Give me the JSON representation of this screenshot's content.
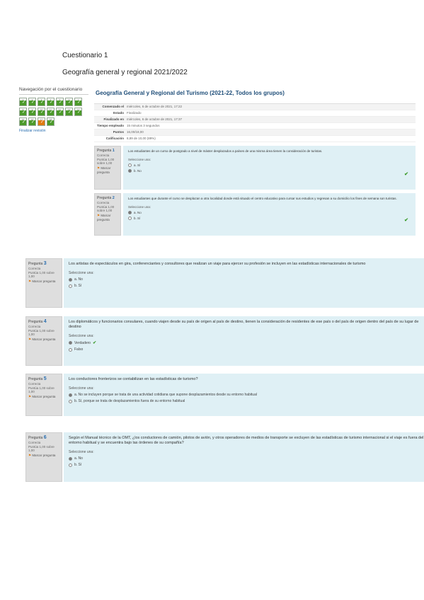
{
  "document": {
    "heading": "Cuestionario 1",
    "subheading": "Geografía general y regional 2021/2022"
  },
  "nav": {
    "title": "Navegación por el cuestionario",
    "cells": [
      "1",
      "2",
      "3",
      "4",
      "5",
      "6",
      "7",
      "8",
      "9",
      "10",
      "11",
      "12",
      "13",
      "14",
      "15",
      "16",
      "17",
      "18"
    ],
    "flagged": [
      16
    ],
    "finish": "Finalizar revisión"
  },
  "course": {
    "title": "Geografía General y Regional del Turismo (2021-22, Todos los grupos)"
  },
  "summary": [
    {
      "k": "Comenzado el",
      "v": "miércoles, 6 de octubre de 2021, 17:22"
    },
    {
      "k": "Estado",
      "v": "Finalizado"
    },
    {
      "k": "Finalizado en",
      "v": "miércoles, 6 de octubre de 2021, 17:37"
    },
    {
      "k": "Tiempo empleado",
      "v": "15 minutos 3 segundos"
    },
    {
      "k": "Puntos",
      "v": "16,00/18,00"
    },
    {
      "k": "Calificación",
      "v": "8,89 de 10,00 (89%)"
    }
  ],
  "question_meta": {
    "prefix": "Pregunta",
    "state": "Correcta",
    "mark": "Puntúa 1,00 sobre 1,00",
    "flag": "Marcar pregunta",
    "prompt": "Seleccione una:"
  },
  "questions": [
    {
      "num": "1",
      "text": "Los estudiantes de un curso de postgrado a nivel de máster desplazados a países de una misma área tienen la consideración de turistas.",
      "options": [
        "a. Sí",
        "b. No"
      ],
      "selected": 1
    },
    {
      "num": "2",
      "text": "Los estudiantes que durante el curso se desplazan a otra localidad donde está situado el centro educativo para cursar sus estudios y regresan a su domicilio los fines de semana son turistas.",
      "options": [
        "a. No",
        "b. Sí"
      ],
      "selected": 0
    },
    {
      "num": "3",
      "text": "Los artistas de espectáculos en gira, conferenciantes y consultores que realizan un viaje para ejercer su profesión se incluyen en las estadísticas internacionales de turismo",
      "options": [
        "a. No",
        "b. Sí"
      ],
      "selected": 0
    },
    {
      "num": "4",
      "text": "Los diplomáticos y funcionarios consulares, cuando viajen desde su país de origen al país de destino, tienen la consideración de residentes de ese país o del país de origen dentro del país de su lugar de destino",
      "options": [
        "Verdadero",
        "Falso"
      ],
      "selected": 0
    },
    {
      "num": "5",
      "text": "Los conductores fronterizos se contabilizan en las estadísticas de turismo?",
      "options": [
        "a. No se incluyen porque se trata de una actividad cotidiana que supone desplazamientos desde su entorno habitual",
        "b. Sí, porque se trata de desplazamientos fuera de su entorno habitual"
      ],
      "selected": 0
    },
    {
      "num": "6",
      "text": "Según el Manual técnico de la OMT, ¿los conductores de camión, pilotos de avión, y otros operadores de medios de transporte se excluyen de las estadísticas de turismo internacional si el viaje es fuera del entorno habitual y se encuentra bajo las órdenes de su compañía?",
      "options": [
        "a. No",
        "b. Sí"
      ],
      "selected": 0
    }
  ]
}
